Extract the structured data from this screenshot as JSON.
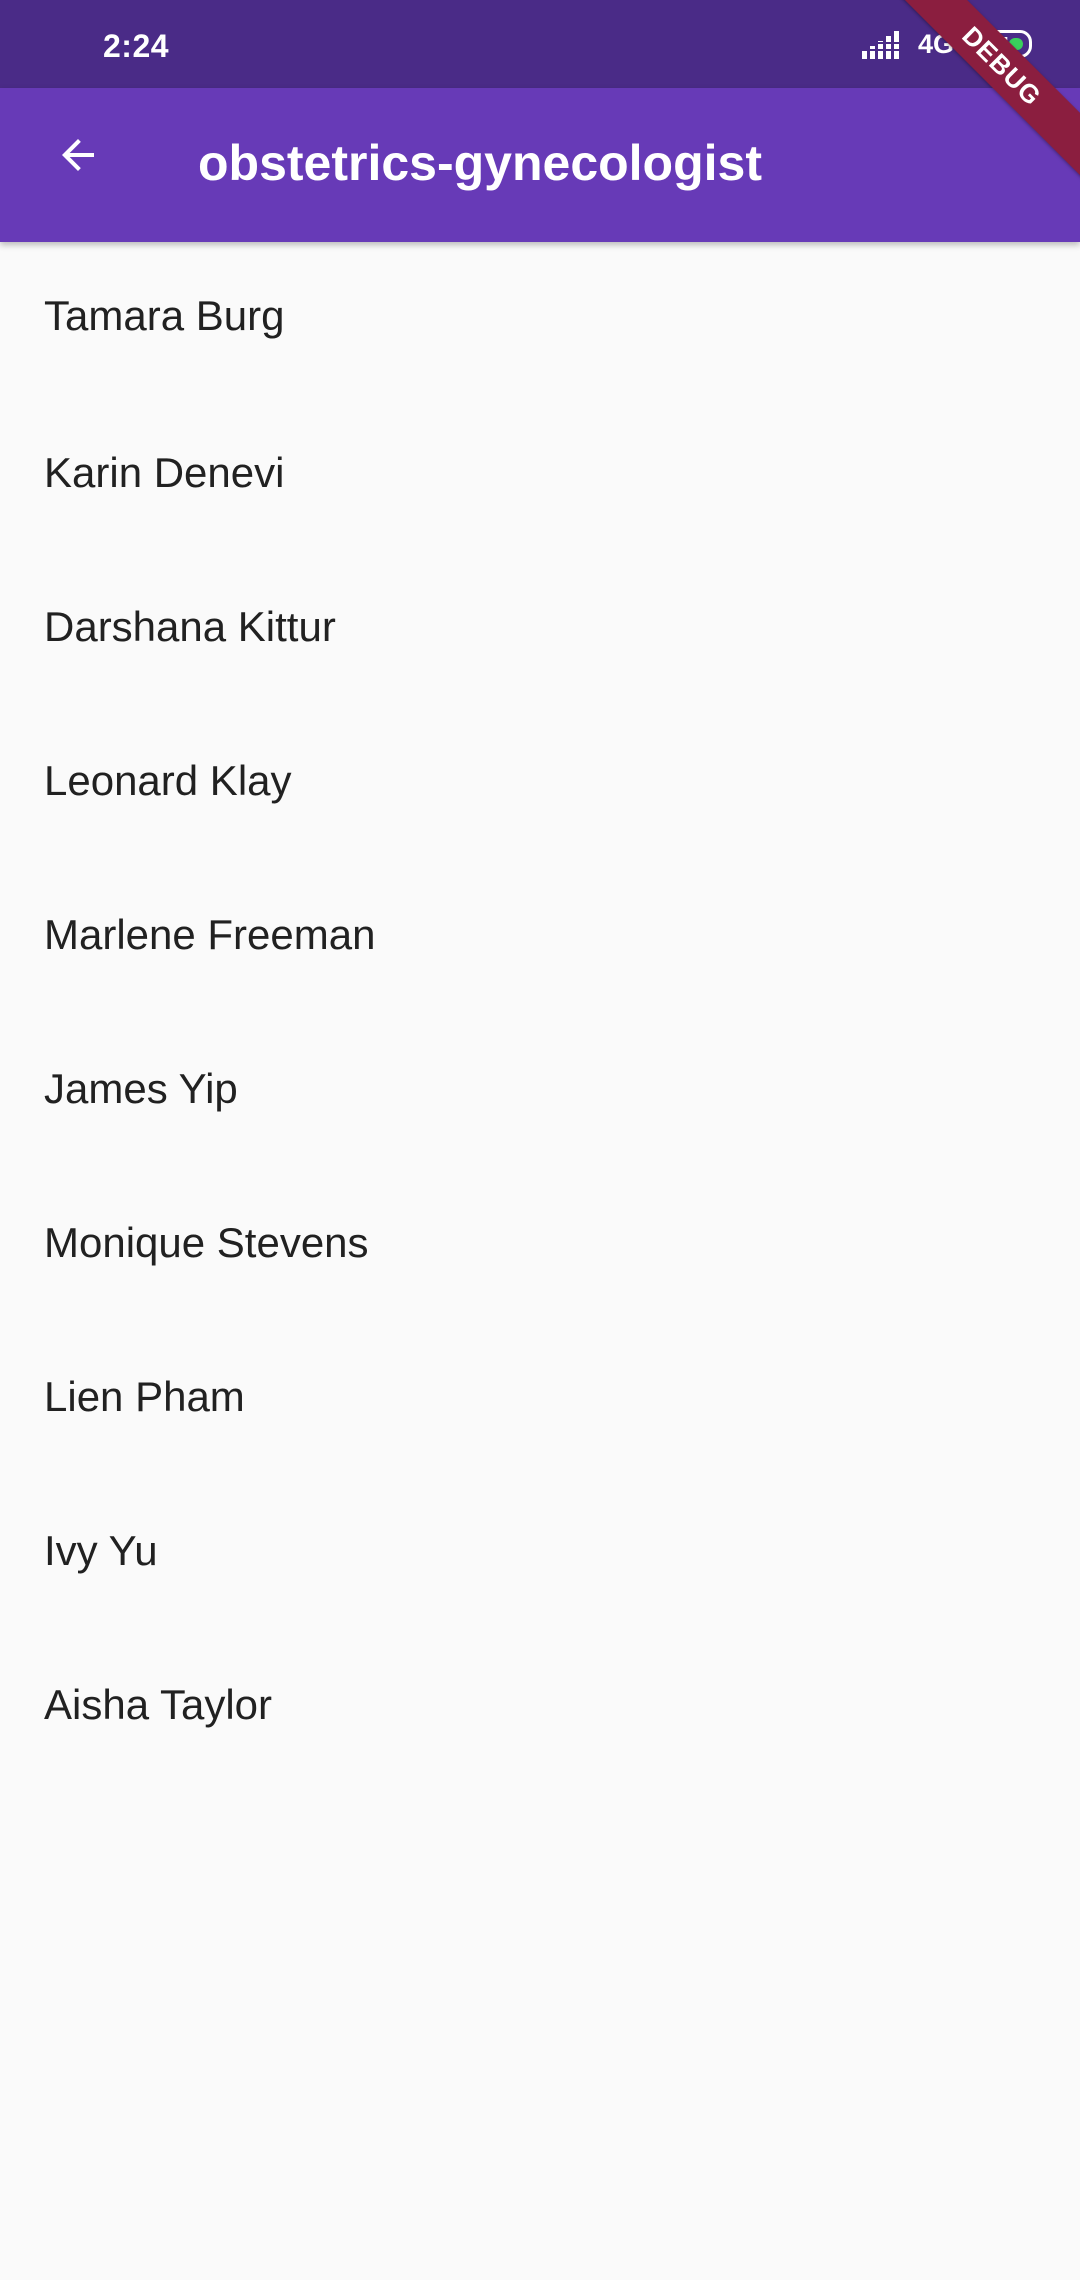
{
  "status_bar": {
    "time": "2:24",
    "network": "4G",
    "battery_level": "24",
    "battery_color": "#39d05c",
    "signal_icon": "signal-bars-icon"
  },
  "app_bar": {
    "title": "obstetrics-gynecologist",
    "back_icon": "arrow-back-icon",
    "color": "#673ab7"
  },
  "debug_banner": "DEBUG",
  "doctors": [
    "Tamara Burg",
    "Karin Denevi",
    "Darshana Kittur",
    "Leonard Klay",
    "Marlene Freeman",
    "James Yip",
    "Monique Stevens",
    "Lien Pham",
    "Ivy Yu",
    "Aisha Taylor"
  ]
}
